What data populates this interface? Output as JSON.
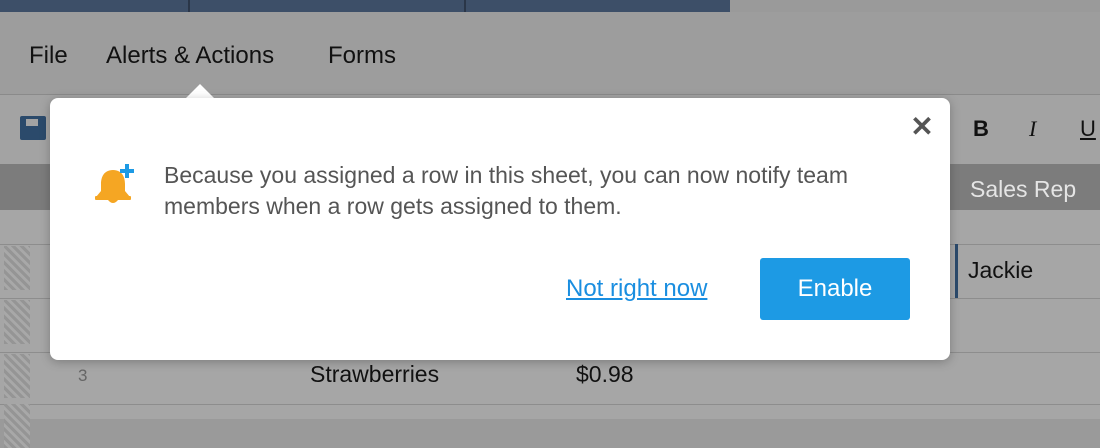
{
  "menu": {
    "file": "File",
    "alerts_actions": "Alerts & Actions",
    "forms": "Forms"
  },
  "toolbar": {
    "bold": "B",
    "italic": "I",
    "underline": "U"
  },
  "grid": {
    "column_header": "Sales Rep",
    "active_cell_value": "Jackie",
    "row3": {
      "number": "3",
      "product": "Strawberries",
      "price": "$0.98"
    }
  },
  "popover": {
    "message": "Because you assigned a row in this sheet, you can now notify team members when a row gets assigned to them.",
    "dismiss_label": "Not right now",
    "enable_label": "Enable",
    "close_glyph": "✕"
  },
  "colors": {
    "accent": "#1d9ae4",
    "link": "#1a8ee0",
    "bell": "#f5a623",
    "overlay": "#9a9a9a"
  },
  "icons": [
    "save-icon",
    "bell-plus-icon",
    "close-icon"
  ]
}
